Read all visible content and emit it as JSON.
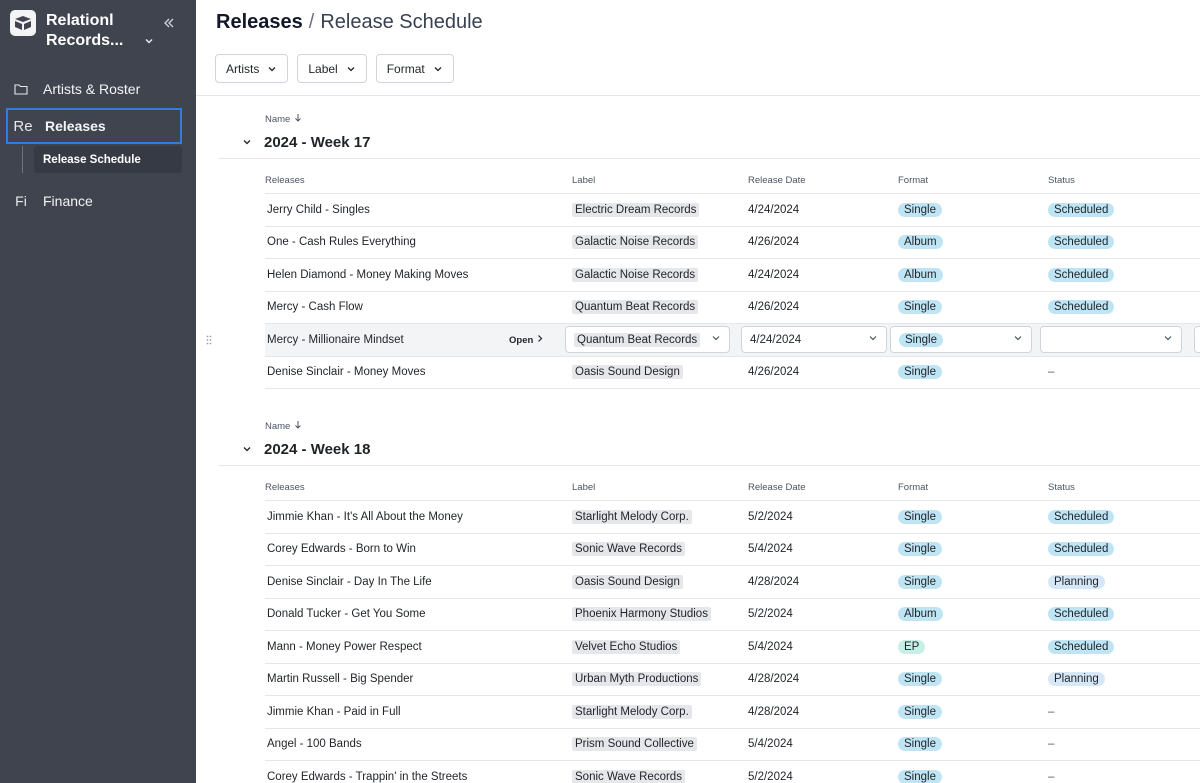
{
  "sidebar": {
    "workspace_name": "Relationl Records...",
    "nav": [
      {
        "icon": "folder-icon",
        "label": "Artists & Roster"
      },
      {
        "icon_text": "Re",
        "label": "Releases"
      },
      {
        "icon_text": "Fi",
        "label": "Finance"
      }
    ],
    "sub_item": "Release Schedule"
  },
  "header": {
    "breadcrumb_root": "Releases",
    "breadcrumb_sep": "/",
    "breadcrumb_current": "Release Schedule",
    "filters": [
      "Artists",
      "Label",
      "Format"
    ]
  },
  "table": {
    "sort_label": "Name",
    "columns": [
      "Releases",
      "Label",
      "Release Date",
      "Format",
      "Status"
    ],
    "open_label": "Open",
    "groups": [
      {
        "title": "2024 - Week 17",
        "rows": [
          {
            "name": "Jerry Child - Singles",
            "label": "Electric Dream Records",
            "date": "4/24/2024",
            "format": "Single",
            "status": "Scheduled"
          },
          {
            "name": "One - Cash Rules Everything",
            "label": "Galactic Noise Records",
            "date": "4/26/2024",
            "format": "Album",
            "status": "Scheduled"
          },
          {
            "name": "Helen Diamond - Money Making Moves",
            "label": "Galactic Noise Records",
            "date": "4/24/2024",
            "format": "Album",
            "status": "Scheduled"
          },
          {
            "name": "Mercy - Cash Flow",
            "label": "Quantum Beat Records",
            "date": "4/26/2024",
            "format": "Single",
            "status": "Scheduled"
          },
          {
            "name": "Mercy - Millionaire Mindset",
            "label": "Quantum Beat Records",
            "date": "4/24/2024",
            "format": "Single",
            "status": ""
          },
          {
            "name": "Denise Sinclair - Money Moves",
            "label": "Oasis Sound Design",
            "date": "4/26/2024",
            "format": "Single",
            "status": "–"
          }
        ]
      },
      {
        "title": "2024 - Week 18",
        "rows": [
          {
            "name": "Jimmie Khan - It's All About the Money",
            "label": "Starlight Melody Corp.",
            "date": "5/2/2024",
            "format": "Single",
            "status": "Scheduled"
          },
          {
            "name": "Corey Edwards - Born to Win",
            "label": "Sonic Wave Records",
            "date": "5/4/2024",
            "format": "Single",
            "status": "Scheduled"
          },
          {
            "name": "Denise Sinclair - Day In The Life",
            "label": "Oasis Sound Design",
            "date": "4/28/2024",
            "format": "Single",
            "status": "Planning"
          },
          {
            "name": "Donald Tucker - Get You Some",
            "label": "Phoenix Harmony Studios",
            "date": "5/2/2024",
            "format": "Album",
            "status": "Scheduled"
          },
          {
            "name": "Mann - Money Power Respect",
            "label": "Velvet Echo Studios",
            "date": "5/4/2024",
            "format": "EP",
            "status": "Scheduled"
          },
          {
            "name": "Martin Russell - Big Spender",
            "label": "Urban Myth Productions",
            "date": "4/28/2024",
            "format": "Single",
            "status": "Planning"
          },
          {
            "name": "Jimmie Khan - Paid in Full",
            "label": "Starlight Melody Corp.",
            "date": "4/28/2024",
            "format": "Single",
            "status": "–"
          },
          {
            "name": "Angel - 100 Bands",
            "label": "Prism Sound Collective",
            "date": "5/4/2024",
            "format": "Single",
            "status": "–"
          },
          {
            "name": "Corey Edwards - Trappin' in the Streets",
            "label": "Sonic Wave Records",
            "date": "5/2/2024",
            "format": "Single",
            "status": "–"
          }
        ]
      }
    ]
  },
  "colors": {
    "sidebar_bg": "#40444f",
    "active_outline": "#2f7de1",
    "format_pill": "#bfe5f5",
    "ep_pill": "#c6f0e6",
    "label_chip": "#e5e7eb"
  }
}
